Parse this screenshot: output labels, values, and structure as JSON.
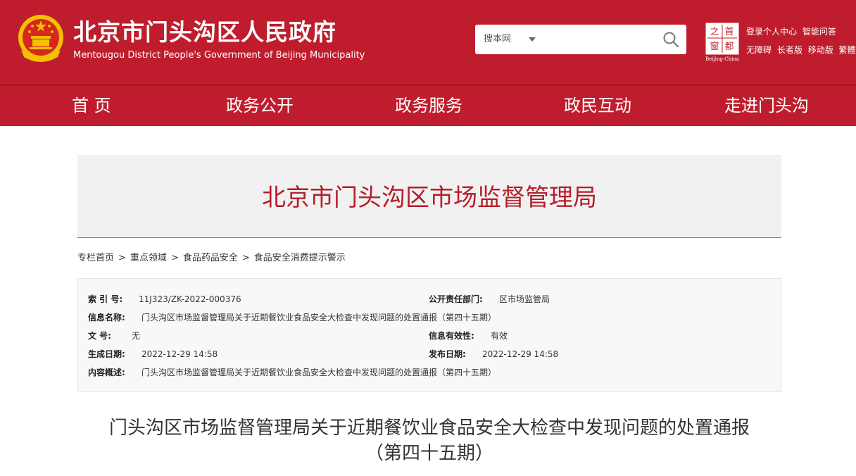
{
  "header": {
    "title": "北京市门头沟区人民政府",
    "subtitle": "Mentougou District People's Government of Beijing Municipality",
    "search": {
      "scope_label": "搜本网",
      "placeholder": ""
    },
    "capital_logo": {
      "chars": [
        "首",
        "都",
        "之",
        "窗"
      ],
      "caption": "Beijing-China"
    },
    "links_row1": [
      "登录个人中心",
      "智能问答"
    ],
    "links_row2": [
      "无障碍",
      "长者版",
      "移动版",
      "繁體"
    ],
    "colors": {
      "brand_red": "#bf1d2d",
      "emblem_gold": "#f2c100"
    }
  },
  "nav": {
    "items": [
      "首 页",
      "政务公开",
      "政务服务",
      "政民互动",
      "走进门头沟"
    ]
  },
  "banner": {
    "title": "北京市门头沟区市场监督管理局"
  },
  "breadcrumb": [
    "专栏首页",
    "重点领域",
    "食品药品安全",
    "食品安全消费提示警示"
  ],
  "breadcrumb_separator": ">",
  "info": {
    "index_label": "索 引 号:",
    "index_value": "11J323/ZK-2022-000376",
    "dept_label": "公开责任部门:",
    "dept_value": "区市场监管局",
    "name_label": "信息名称:",
    "name_value": "门头沟区市场监督管理局关于近期餐饮业食品安全大检查中发现问题的处置通报（第四十五期）",
    "docno_label": "文 号:",
    "docno_value": "无",
    "validity_label": "信息有效性:",
    "validity_value": "有效",
    "created_label": "生成日期:",
    "created_value": "2022-12-29 14:58",
    "published_label": "发布日期:",
    "published_value": "2022-12-29 14:58",
    "summary_label": "内容概述:",
    "summary_value": "门头沟区市场监督管理局关于近期餐饮业食品安全大检查中发现问题的处置通报（第四十五期）"
  },
  "article": {
    "title_line1": "门头沟区市场监督管理局关于近期餐饮业食品安全大检查中发现问题的处置通报",
    "title_line2": "（第四十五期）"
  }
}
